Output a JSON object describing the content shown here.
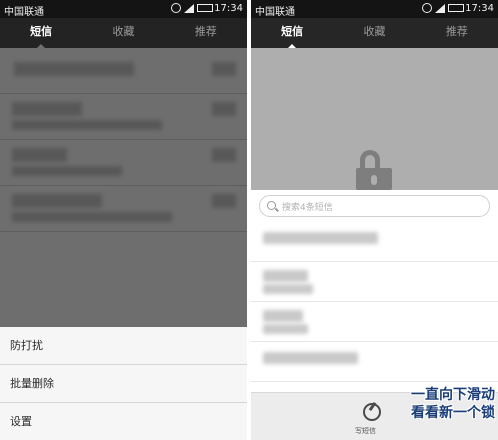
{
  "status_bar": {
    "carrier": "中国联通",
    "time": "17:34"
  },
  "tabs": [
    {
      "label": "短信"
    },
    {
      "label": "收藏"
    },
    {
      "label": "推荐"
    }
  ],
  "left_phone": {
    "menu": {
      "items": [
        {
          "label": "防打扰"
        },
        {
          "label": "批量删除"
        },
        {
          "label": "设置"
        }
      ]
    }
  },
  "right_phone": {
    "search": {
      "placeholder": "搜索4条短信"
    },
    "bottom_bar": {
      "compose_label": "写短信"
    },
    "overlay_text": {
      "line1": "一直向下滑动",
      "line2": "看看新一个锁"
    }
  },
  "colors": {
    "status_bg": "#141414",
    "tab_bg": "#262626",
    "lock_area": "#aeaeae",
    "overlay_text": "#1b3e78"
  },
  "icons": [
    "alarm-icon",
    "signal-icon",
    "battery-icon",
    "unlock-icon",
    "search-icon",
    "compose-icon"
  ]
}
